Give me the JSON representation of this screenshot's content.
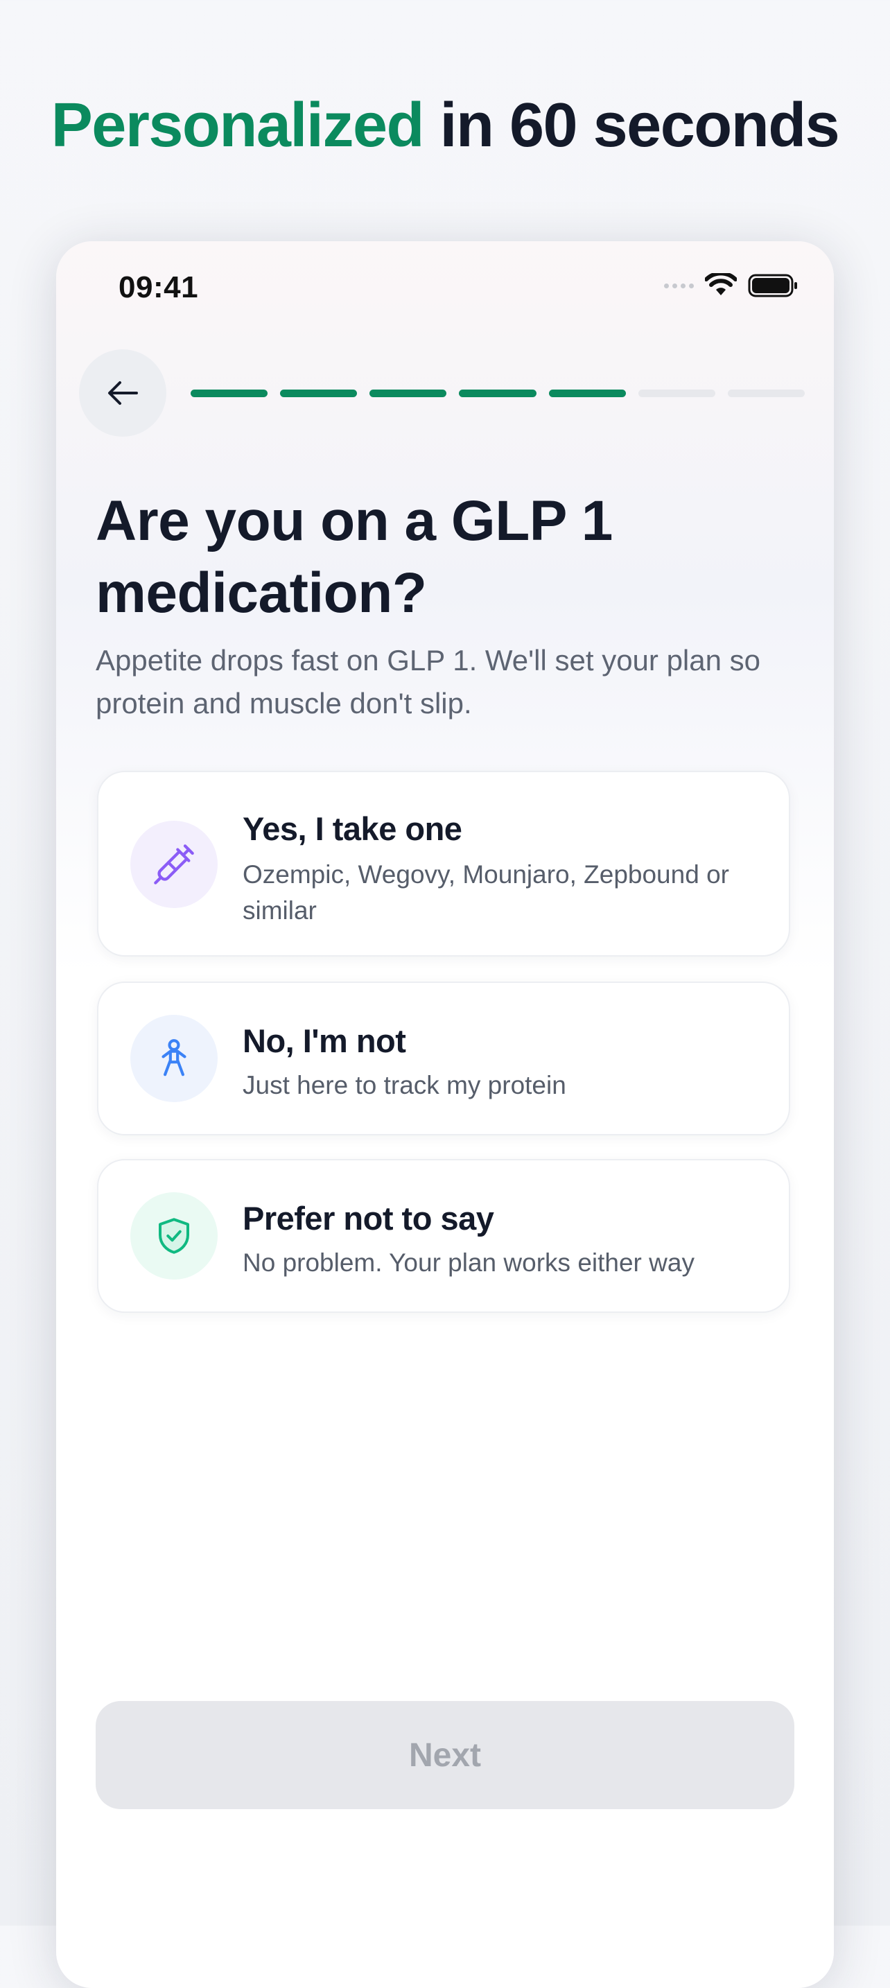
{
  "headline": {
    "accent": "Personalized",
    "rest": " in 60 seconds"
  },
  "status_bar": {
    "time": "09:41"
  },
  "progress": {
    "completed_steps": 5,
    "total_steps": 7
  },
  "question": {
    "title": "Are you on a GLP 1 medication?",
    "subtitle": "Appetite drops fast on GLP 1. We'll set your plan so protein and muscle don't slip."
  },
  "options": [
    {
      "title": "Yes, I take one",
      "description": "Ozempic, Wegovy, Mounjaro, Zepbound or similar",
      "icon": "syringe-icon"
    },
    {
      "title": "No, I'm not",
      "description": "Just here to track my protein",
      "icon": "person-icon"
    },
    {
      "title": "Prefer not to say",
      "description": "No problem. Your plan works either way",
      "icon": "shield-check-icon"
    }
  ],
  "next_button": {
    "label": "Next"
  },
  "colors": {
    "accent": "#0b8a5e",
    "text_primary": "#141a2a",
    "syringe_icon": "#8b5cf6",
    "person_icon": "#3b82f6",
    "shield_icon": "#10b981"
  }
}
